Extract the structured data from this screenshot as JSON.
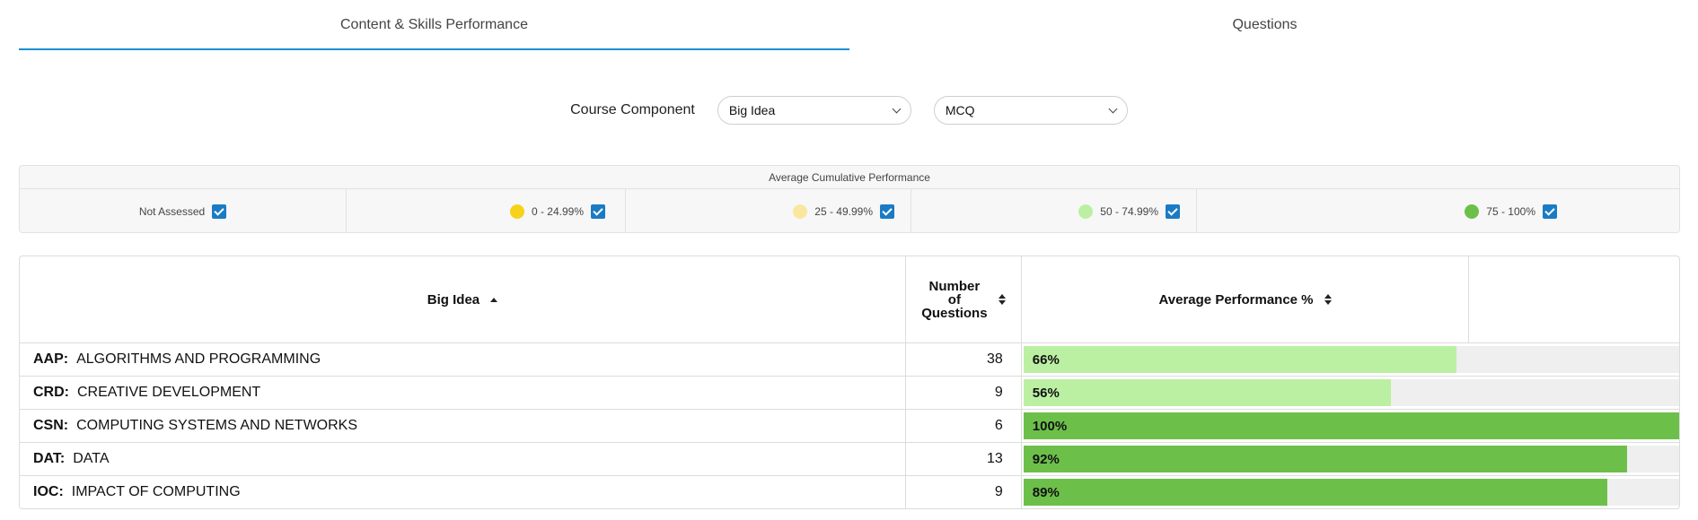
{
  "tabs": [
    {
      "label": "Content & Skills Performance",
      "active": true
    },
    {
      "label": "Questions",
      "active": false
    }
  ],
  "filters": {
    "label": "Course Component",
    "component_value": "Big Idea",
    "type_value": "MCQ"
  },
  "legend": {
    "title": "Average Cumulative Performance",
    "items": [
      {
        "label": "Not Assessed",
        "color": null,
        "checked": true
      },
      {
        "label": "0 - 24.99%",
        "color": "#f6d31a",
        "checked": true
      },
      {
        "label": "25 - 49.99%",
        "color": "#f9e7a1",
        "checked": true
      },
      {
        "label": "50 - 74.99%",
        "color": "#bbf0a3",
        "checked": true
      },
      {
        "label": "75 - 100%",
        "color": "#6cc04a",
        "checked": true
      }
    ]
  },
  "table": {
    "headers": {
      "big_idea": "Big Idea",
      "num_q_line1": "Number",
      "num_q_line2": "of",
      "num_q_line3": "Questions",
      "avg_perf": "Average Performance %"
    },
    "rows": [
      {
        "code": "AAP:",
        "name": "ALGORITHMS AND PROGRAMMING",
        "questions": "38",
        "percent_label": "66%",
        "percent": 66,
        "color": "#bbf0a3"
      },
      {
        "code": "CRD:",
        "name": "CREATIVE DEVELOPMENT",
        "questions": "9",
        "percent_label": "56%",
        "percent": 56,
        "color": "#bbf0a3"
      },
      {
        "code": "CSN:",
        "name": "COMPUTING SYSTEMS AND NETWORKS",
        "questions": "6",
        "percent_label": "100%",
        "percent": 100,
        "color": "#6cc04a"
      },
      {
        "code": "DAT:",
        "name": "DATA",
        "questions": "13",
        "percent_label": "92%",
        "percent": 92,
        "color": "#6cc04a"
      },
      {
        "code": "IOC:",
        "name": "IMPACT OF COMPUTING",
        "questions": "9",
        "percent_label": "89%",
        "percent": 89,
        "color": "#6cc04a"
      }
    ]
  },
  "colors": {
    "accent": "#1a8fd1",
    "checkbox": "#1a7bc4"
  },
  "icons": {
    "select_arrow": "chevron-down-icon",
    "sort_asc": "sort-ascending-icon",
    "sort_both": "sort-icon",
    "checkbox": "checkbox-checked-icon"
  }
}
